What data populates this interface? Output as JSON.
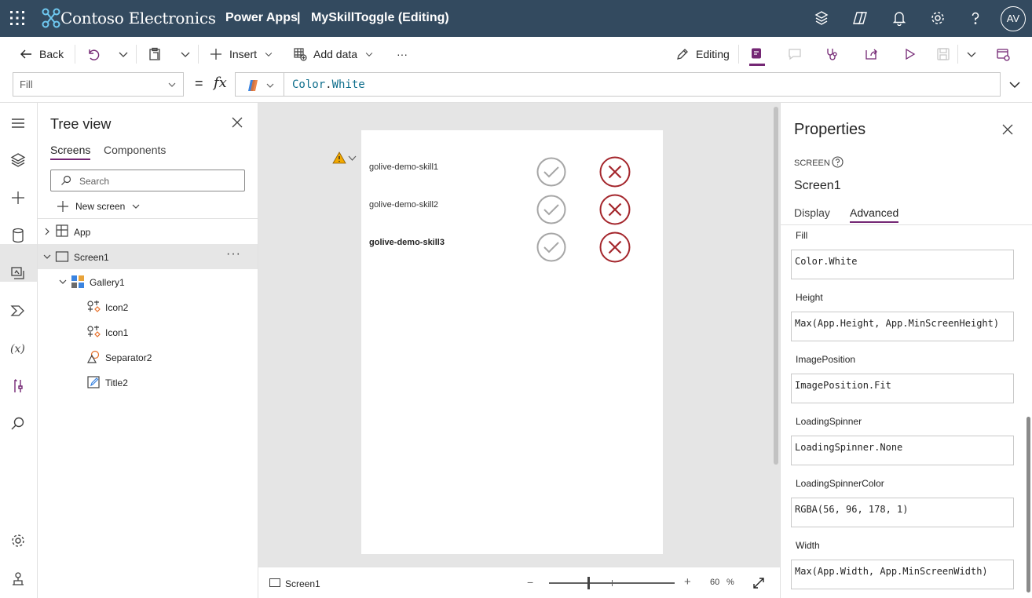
{
  "header": {
    "org_name": "Contoso Electronics",
    "app_name": "Power Apps",
    "separator": "|",
    "document_title": "MySkillToggle (Editing)",
    "avatar_initials": "AV"
  },
  "commandbar": {
    "back": "Back",
    "insert": "Insert",
    "add_data": "Add data",
    "more": "···",
    "editing": "Editing"
  },
  "formula": {
    "property": "Fill",
    "equals": "=",
    "fx": "fx",
    "value_obj": "Color",
    "value_dot": ".",
    "value_member": "White"
  },
  "treeview": {
    "title": "Tree view",
    "tabs": [
      "Screens",
      "Components"
    ],
    "search_placeholder": "Search",
    "new_screen": "New screen",
    "items": {
      "app": "App",
      "screen1": "Screen1",
      "more": "···",
      "gallery1": "Gallery1",
      "icon2": "Icon2",
      "icon1": "Icon1",
      "separator2": "Separator2",
      "title2": "Title2"
    }
  },
  "canvas": {
    "skills": [
      "golive-demo-skill1",
      "golive-demo-skill2",
      "golive-demo-skill3"
    ],
    "footer_screen": "Screen1",
    "zoom_value": "60",
    "zoom_unit": "%",
    "zoom_minus": "−",
    "zoom_plus": "+"
  },
  "properties": {
    "title": "Properties",
    "kind": "SCREEN",
    "control_name": "Screen1",
    "tabs": [
      "Display",
      "Advanced"
    ],
    "fields": [
      {
        "label": "Fill",
        "value": "Color.White"
      },
      {
        "label": "Height",
        "value": "Max(App.Height, App.MinScreenHeight)"
      },
      {
        "label": "ImagePosition",
        "value": "ImagePosition.Fit"
      },
      {
        "label": "LoadingSpinner",
        "value": "LoadingSpinner.None"
      },
      {
        "label": "LoadingSpinnerColor",
        "value": "RGBA(56, 96, 178, 1)"
      },
      {
        "label": "Width",
        "value": "Max(App.Width, App.MinScreenWidth)"
      }
    ]
  },
  "colors": {
    "header_bg": "#334a5f",
    "accent": "#742774",
    "check_gray": "#a6a6a6",
    "x_red": "#a4262c",
    "warning": "#f2a900"
  }
}
